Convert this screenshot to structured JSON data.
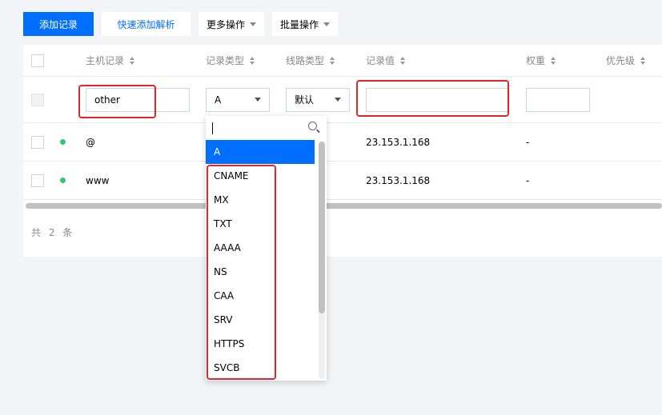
{
  "toolbar": {
    "add_record": "添加记录",
    "quick_add": "快速添加解析",
    "more_actions": "更多操作",
    "batch_actions": "批量操作"
  },
  "table": {
    "columns": [
      "主机记录",
      "记录类型",
      "线路类型",
      "记录值",
      "权重",
      "优先级"
    ],
    "edit_row": {
      "host_value": "other",
      "type_value": "A",
      "line_value": "默认",
      "record_value": "",
      "weight_value": ""
    },
    "rows": [
      {
        "host": "@",
        "value": "23.153.1.168",
        "weight": "-"
      },
      {
        "host": "www",
        "value": "23.153.1.168",
        "weight": "-"
      }
    ],
    "total": "共 2 条"
  },
  "dropdown": {
    "search_value": "",
    "options": [
      "A",
      "CNAME",
      "MX",
      "TXT",
      "AAAA",
      "NS",
      "CAA",
      "SRV",
      "HTTPS",
      "SVCB"
    ],
    "selected": "A"
  },
  "colors": {
    "accent": "#006eff",
    "status_ok": "#29cc6a",
    "highlight": "#e5252a"
  }
}
